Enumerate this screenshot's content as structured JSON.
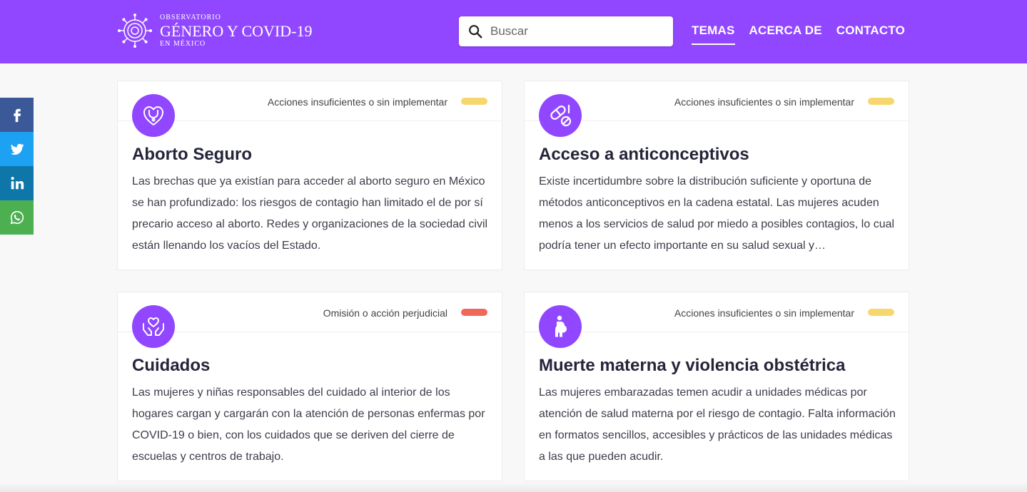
{
  "header": {
    "logo": {
      "top": "OBSERVATORIO",
      "main": "GÉNERO Y COVID-19",
      "bottom": "EN MÉXICO"
    },
    "search": {
      "placeholder": "Buscar",
      "icon": "search-icon"
    },
    "nav": [
      {
        "label": "TEMAS",
        "active": true
      },
      {
        "label": "ACERCA DE",
        "active": false
      },
      {
        "label": "CONTACTO",
        "active": false
      }
    ]
  },
  "social": [
    {
      "name": "facebook-icon",
      "color": "#3b5998"
    },
    {
      "name": "twitter-icon",
      "color": "#1da1f2"
    },
    {
      "name": "linkedin-icon",
      "color": "#0e76a8"
    },
    {
      "name": "whatsapp-icon",
      "color": "#4caf50"
    }
  ],
  "cards": [
    {
      "title": "Aborto Seguro",
      "status": "Acciones insuficientes o sin implementar",
      "status_color": "#f5d76e",
      "icon": "heart-stethoscope-icon",
      "text": "Las brechas que ya existían para acceder al aborto seguro en México se han profundizado: los riesgos de contagio han limitado el de por sí precario acceso al aborto. Redes y organizaciones de la sociedad civil están llenando los vacíos del Estado."
    },
    {
      "title": "Acceso a anticonceptivos",
      "status": "Acciones insuficientes o sin implementar",
      "status_color": "#f5d76e",
      "icon": "pills-icon",
      "text": "Existe incertidumbre sobre la distribución suficiente y oportuna de métodos anticonceptivos en la cadena estatal. Las mujeres acuden menos a los servicios de salud por miedo a posibles contagios, lo cual podría tener un efecto importante en su salud sexual y…"
    },
    {
      "title": "Cuidados",
      "status": "Omisión o acción perjudicial",
      "status_color": "#f0685a",
      "icon": "hands-heart-icon",
      "text": "Las mujeres y niñas responsables del cuidado al interior de los hogares cargan y cargarán con la atención de personas enfermas por COVID-19 o bien, con los cuidados que se deriven del cierre de escuelas y centros de trabajo."
    },
    {
      "title": "Muerte materna y violencia obstétrica",
      "status": "Acciones insuficientes o sin implementar",
      "status_color": "#f5d76e",
      "icon": "pregnant-woman-icon",
      "text": "Las mujeres embarazadas temen acudir a unidades médicas por atención de salud materna por el riesgo de contagio. Falta información en formatos sencillos, accesibles y prácticos de las unidades médicas a las que pueden acudir."
    }
  ]
}
